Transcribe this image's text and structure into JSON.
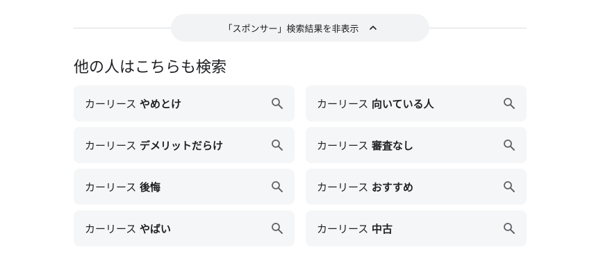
{
  "sponsored_toggle": {
    "label": "「スポンサー」検索結果を非表示",
    "icon": "chevron-up-icon"
  },
  "related": {
    "heading": "他の人はこちらも検索",
    "items": [
      {
        "base": "カーリース ",
        "bold": "やめとけ"
      },
      {
        "base": "カーリース ",
        "bold": "向いている人"
      },
      {
        "base": "カーリース ",
        "bold": "デメリットだらけ"
      },
      {
        "base": "カーリース ",
        "bold": "審査なし"
      },
      {
        "base": "カーリース ",
        "bold": "後悔"
      },
      {
        "base": "カーリース ",
        "bold": "おすすめ"
      },
      {
        "base": "カーリース ",
        "bold": "やばい"
      },
      {
        "base": "カーリース ",
        "bold": "中古"
      }
    ]
  },
  "colors": {
    "chip_bg": "#f5f6f7",
    "pill_bg": "#f1f3f4",
    "divider": "#dadce0",
    "text": "#202124",
    "icon": "#5f6368"
  }
}
